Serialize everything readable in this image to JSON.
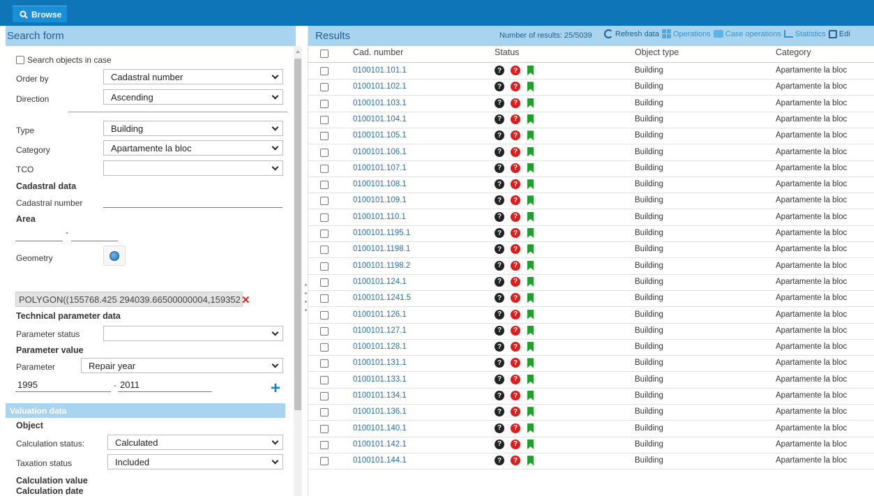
{
  "topbar": {
    "browse_label": "Browse"
  },
  "search": {
    "header": "Search form",
    "search_in_case": "Search objects in case",
    "order_by_label": "Order by",
    "order_by_value": "Cadastral number",
    "direction_label": "Direction",
    "direction_value": "Ascending",
    "type_label": "Type",
    "type_value": "Building",
    "category_label": "Category",
    "category_value": "Apartamente la bloc",
    "tco_label": "TCO",
    "tco_value": "",
    "cadastral_data": "Cadastral data",
    "cadastral_number_label": "Cadastral number",
    "area_label": "Area",
    "geometry_label": "Geometry",
    "geometry_value": "POLYGON((155768.425 294039.66500000004,159352",
    "technical_parameter_data": "Technical parameter data",
    "parameter_status_label": "Parameter status",
    "parameter_value_label": "Parameter value",
    "parameter_label": "Parameter",
    "parameter_value": "Repair year",
    "range_from": "1995",
    "range_to": "2011",
    "valuation_data": "Valuation data",
    "object_label": "Object",
    "calc_status_label": "Calculation status:",
    "calc_status_value": "Calculated",
    "taxation_status_label": "Taxation status",
    "taxation_status_value": "Included",
    "calc_value_label": "Calculation value",
    "calc_date_label": "Calculation date"
  },
  "results": {
    "title": "Results",
    "count_text": "Number of results: 25/5039",
    "toolbar": {
      "refresh": "Refresh data",
      "operations": "Operations",
      "case_operations": "Case operations",
      "statistics": "Statistics",
      "edit": "Edi"
    },
    "columns": {
      "cad": "Cad. number",
      "status": "Status",
      "object_type": "Object type",
      "category": "Category"
    },
    "rows": [
      {
        "cad": "0100101.101.1",
        "type": "Building",
        "category": "Apartamente la bloc"
      },
      {
        "cad": "0100101.102.1",
        "type": "Building",
        "category": "Apartamente la bloc"
      },
      {
        "cad": "0100101.103.1",
        "type": "Building",
        "category": "Apartamente la bloc"
      },
      {
        "cad": "0100101.104.1",
        "type": "Building",
        "category": "Apartamente la bloc"
      },
      {
        "cad": "0100101.105.1",
        "type": "Building",
        "category": "Apartamente la bloc"
      },
      {
        "cad": "0100101.106.1",
        "type": "Building",
        "category": "Apartamente la bloc"
      },
      {
        "cad": "0100101.107.1",
        "type": "Building",
        "category": "Apartamente la bloc"
      },
      {
        "cad": "0100101.108.1",
        "type": "Building",
        "category": "Apartamente la bloc"
      },
      {
        "cad": "0100101.109.1",
        "type": "Building",
        "category": "Apartamente la bloc"
      },
      {
        "cad": "0100101.110.1",
        "type": "Building",
        "category": "Apartamente la bloc"
      },
      {
        "cad": "0100101.1195.1",
        "type": "Building",
        "category": "Apartamente la bloc"
      },
      {
        "cad": "0100101.1198.1",
        "type": "Building",
        "category": "Apartamente la bloc"
      },
      {
        "cad": "0100101.1198.2",
        "type": "Building",
        "category": "Apartamente la bloc"
      },
      {
        "cad": "0100101.124.1",
        "type": "Building",
        "category": "Apartamente la bloc"
      },
      {
        "cad": "0100101.1241.5",
        "type": "Building",
        "category": "Apartamente la bloc"
      },
      {
        "cad": "0100101.126.1",
        "type": "Building",
        "category": "Apartamente la bloc"
      },
      {
        "cad": "0100101.127.1",
        "type": "Building",
        "category": "Apartamente la bloc"
      },
      {
        "cad": "0100101.128.1",
        "type": "Building",
        "category": "Apartamente la bloc"
      },
      {
        "cad": "0100101.131.1",
        "type": "Building",
        "category": "Apartamente la bloc"
      },
      {
        "cad": "0100101.133.1",
        "type": "Building",
        "category": "Apartamente la bloc"
      },
      {
        "cad": "0100101.134.1",
        "type": "Building",
        "category": "Apartamente la bloc"
      },
      {
        "cad": "0100101.136.1",
        "type": "Building",
        "category": "Apartamente la bloc"
      },
      {
        "cad": "0100101.140.1",
        "type": "Building",
        "category": "Apartamente la bloc"
      },
      {
        "cad": "0100101.142.1",
        "type": "Building",
        "category": "Apartamente la bloc"
      },
      {
        "cad": "0100101.144.1",
        "type": "Building",
        "category": "Apartamente la bloc"
      }
    ]
  },
  "colors": {
    "topbar": "#0e75b8",
    "pane_header": "#a8d4ef",
    "link": "#1f6fb2",
    "status_ok": "#1fa02c",
    "status_err": "#e01b1b"
  }
}
